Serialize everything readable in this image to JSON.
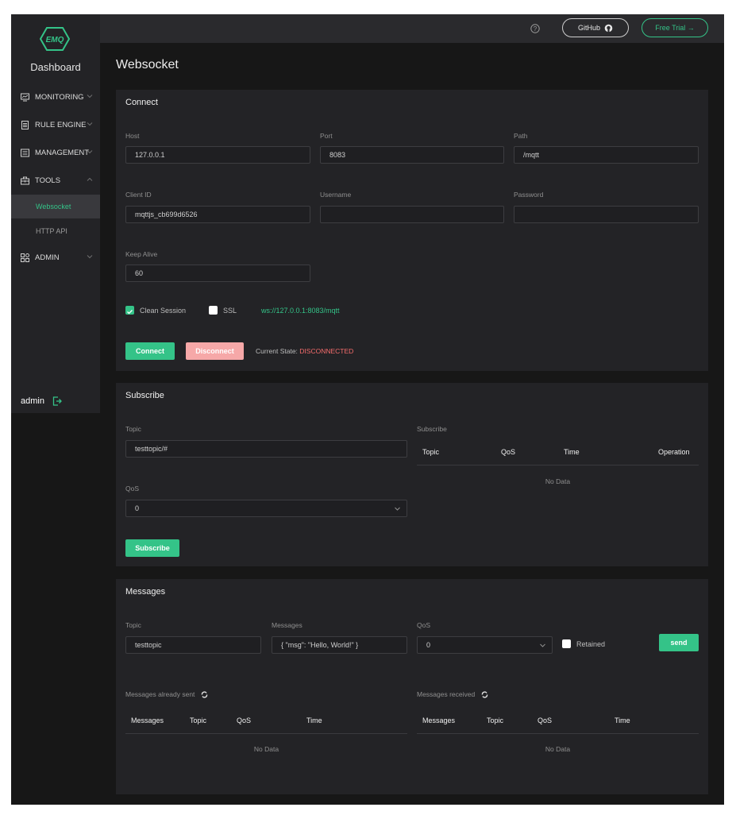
{
  "sidebar": {
    "logo_text": "EMQ",
    "title": "Dashboard",
    "items": [
      {
        "label": "MONITORING"
      },
      {
        "label": "RULE ENGINE"
      },
      {
        "label": "MANAGEMENT"
      },
      {
        "label": "TOOLS"
      },
      {
        "label": "ADMIN"
      }
    ],
    "tools_sub": [
      {
        "label": "Websocket"
      },
      {
        "label": "HTTP API"
      }
    ],
    "user": "admin"
  },
  "header": {
    "github_label": "GitHub",
    "trial_label": "Free Trial →"
  },
  "page_title": "Websocket",
  "connect": {
    "title": "Connect",
    "host_label": "Host",
    "host_value": "127.0.0.1",
    "port_label": "Port",
    "port_value": "8083",
    "path_label": "Path",
    "path_value": "/mqtt",
    "client_id_label": "Client ID",
    "client_id_value": "mqttjs_cb699d6526",
    "username_label": "Username",
    "username_value": "",
    "password_label": "Password",
    "password_value": "",
    "keepalive_label": "Keep Alive",
    "keepalive_value": "60",
    "clean_session_label": "Clean Session",
    "ssl_label": "SSL",
    "url": "ws://127.0.0.1:8083/mqtt",
    "connect_button": "Connect",
    "disconnect_button": "Disconnect",
    "state_label": "Current State:",
    "state_value": "DISCONNECTED"
  },
  "subscribe": {
    "title": "Subscribe",
    "topic_label": "Topic",
    "topic_value": "testtopic/#",
    "qos_label": "QoS",
    "qos_value": "0",
    "button": "Subscribe",
    "table_label": "Subscribe",
    "columns": [
      "Topic",
      "QoS",
      "Time",
      "Operation"
    ],
    "no_data": "No Data"
  },
  "messages": {
    "title": "Messages",
    "topic_label": "Topic",
    "topic_value": "testtopic",
    "messages_label": "Messages",
    "messages_value": "{ \"msg\": \"Hello, World!\" }",
    "qos_label": "QoS",
    "qos_value": "0",
    "retained_label": "Retained",
    "send_button": "send",
    "sent_label": "Messages already sent",
    "received_label": "Messages received",
    "sent_columns": [
      "Messages",
      "Topic",
      "QoS",
      "Time"
    ],
    "received_columns": [
      "Messages",
      "Topic",
      "QoS",
      "Time"
    ],
    "sent_no_data": "No Data",
    "received_no_data": "No Data"
  },
  "colors": {
    "accent": "#34c388",
    "danger": "#f56c6c",
    "disabled_pink": "#f6a8a8",
    "panel": "#232326",
    "background": "#171717"
  }
}
